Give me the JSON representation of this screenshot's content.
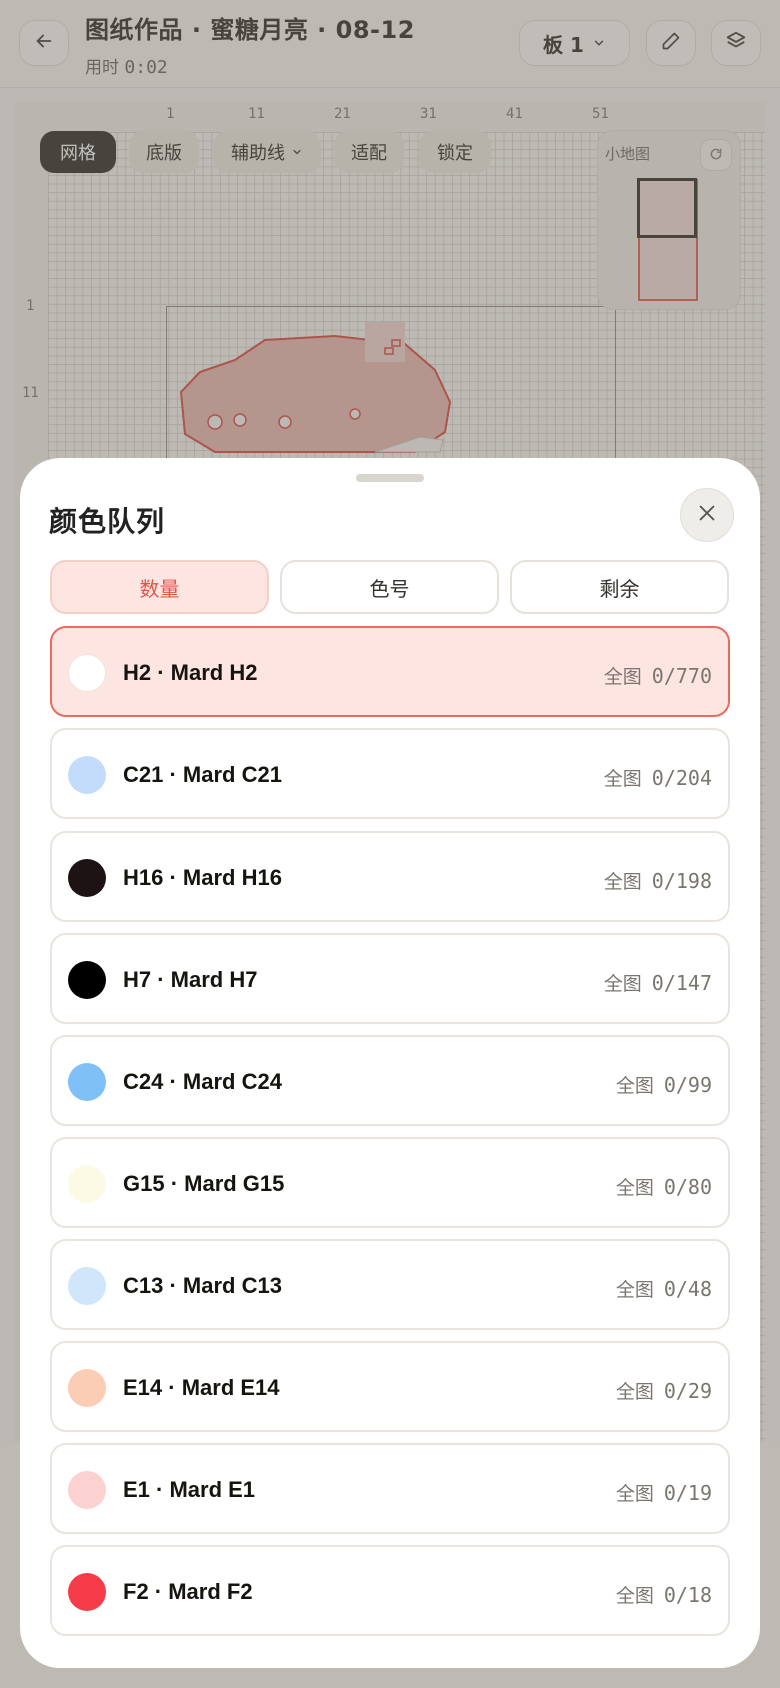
{
  "header": {
    "title": "图纸作品 · 蜜糖月亮 · 08-12",
    "timer_label": "用时",
    "timer_value": "0:02",
    "board_label": "板 1"
  },
  "toolbar": {
    "grid": "网格",
    "base": "底版",
    "guides": "辅助线",
    "fit": "适配",
    "lock": "锁定"
  },
  "ruler": {
    "top": [
      "1",
      "11",
      "21",
      "31",
      "41",
      "51"
    ],
    "left": [
      "1",
      "11"
    ]
  },
  "minimap": {
    "title": "小地图"
  },
  "sheet": {
    "title": "颜色队列",
    "tabs": [
      {
        "label": "数量",
        "active": true
      },
      {
        "label": "色号",
        "active": false
      },
      {
        "label": "剩余",
        "active": false
      }
    ],
    "rows": [
      {
        "label": "H2 · Mard H2",
        "scope": "全图",
        "count": "0/770",
        "color": "#ffffff",
        "selected": true
      },
      {
        "label": "C21 · Mard C21",
        "scope": "全图",
        "count": "0/204",
        "color": "#c3dcfb",
        "selected": false
      },
      {
        "label": "H16 · Mard H16",
        "scope": "全图",
        "count": "0/198",
        "color": "#1d1314",
        "selected": false
      },
      {
        "label": "H7 · Mard H7",
        "scope": "全图",
        "count": "0/147",
        "color": "#000000",
        "selected": false
      },
      {
        "label": "C24 · Mard C24",
        "scope": "全图",
        "count": "0/99",
        "color": "#7fc0f6",
        "selected": false
      },
      {
        "label": "G15 · Mard G15",
        "scope": "全图",
        "count": "0/80",
        "color": "#fbfbe5",
        "selected": false
      },
      {
        "label": "C13 · Mard C13",
        "scope": "全图",
        "count": "0/48",
        "color": "#cfe6fb",
        "selected": false
      },
      {
        "label": "E14 · Mard E14",
        "scope": "全图",
        "count": "0/29",
        "color": "#fccdb5",
        "selected": false
      },
      {
        "label": "E1 · Mard E1",
        "scope": "全图",
        "count": "0/19",
        "color": "#fbd2cf",
        "selected": false
      },
      {
        "label": "F2 · Mard F2",
        "scope": "全图",
        "count": "0/18",
        "color": "#f63c48",
        "selected": false
      }
    ]
  }
}
